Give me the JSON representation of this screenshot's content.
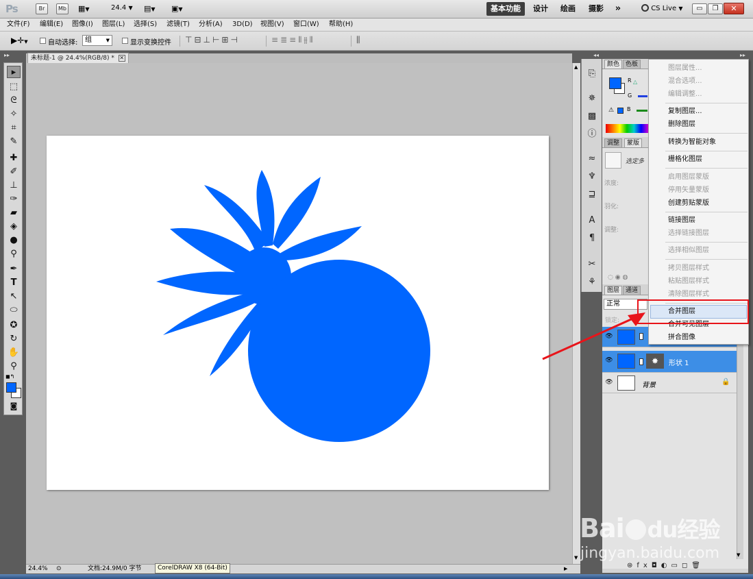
{
  "app": {
    "logo": "Ps",
    "bridge_btn": "Br",
    "minibridge_btn": "Mb",
    "zoom_value": "24.4",
    "workspaces": [
      "基本功能",
      "设计",
      "绘画",
      "摄影"
    ],
    "more": "»",
    "cs_live": "CS Live"
  },
  "menubar": {
    "items": [
      "文件(F)",
      "编辑(E)",
      "图像(I)",
      "图层(L)",
      "选择(S)",
      "滤镜(T)",
      "分析(A)",
      "3D(D)",
      "视图(V)",
      "窗口(W)",
      "帮助(H)"
    ]
  },
  "options": {
    "auto_select_label": "自动选择:",
    "auto_select_value": "组",
    "transform_label": "显示变换控件"
  },
  "document": {
    "tab_title": "未标题-1 @ 24.4%(RGB/8) *",
    "shape_color": "#0066ff",
    "canvas_color": "#ffffff"
  },
  "status": {
    "zoom": "24.4%",
    "doc_info": "文档:24.9M/0 字节",
    "taskbar_tooltip": "CorelDRAW X8 (64-Bit)"
  },
  "panels": {
    "color_tab": "颜色",
    "swatch_tab": "色板",
    "adjust_tab": "调整",
    "mask_tab": "蒙版",
    "mask_select": "选定多",
    "density_label": "浓度:",
    "feather_label": "羽化:",
    "refine_label": "调整:",
    "channels_r": "R",
    "channels_g": "G",
    "channels_b": "B",
    "layers_tab": "图层",
    "channels_tab": "通道",
    "blend_mode": "正常",
    "lock_label": "锁定:"
  },
  "layers": [
    {
      "name": "形状 1",
      "selected": true,
      "visible": true
    },
    {
      "name": "背景",
      "selected": false,
      "visible": true
    }
  ],
  "context_menu": {
    "groups": [
      [
        {
          "label": "图层属性...",
          "enabled": false
        },
        {
          "label": "混合选项...",
          "enabled": false
        },
        {
          "label": "编辑调整...",
          "enabled": false
        }
      ],
      [
        {
          "label": "复制图层...",
          "enabled": true
        },
        {
          "label": "删除图层",
          "enabled": true
        }
      ],
      [
        {
          "label": "转换为智能对象",
          "enabled": true
        }
      ],
      [
        {
          "label": "栅格化图层",
          "enabled": true
        }
      ],
      [
        {
          "label": "启用图层蒙版",
          "enabled": false
        },
        {
          "label": "停用矢量蒙版",
          "enabled": false
        },
        {
          "label": "创建剪贴蒙版",
          "enabled": true
        }
      ],
      [
        {
          "label": "链接图层",
          "enabled": true
        },
        {
          "label": "选择链接图层",
          "enabled": false
        }
      ],
      [
        {
          "label": "选择相似图层",
          "enabled": false
        }
      ],
      [
        {
          "label": "拷贝图层样式",
          "enabled": false
        },
        {
          "label": "粘贴图层样式",
          "enabled": false
        },
        {
          "label": "清除图层样式",
          "enabled": false
        }
      ],
      [
        {
          "label": "合并图层",
          "enabled": true,
          "highlighted": true
        },
        {
          "label": "合并可见图层",
          "enabled": true
        },
        {
          "label": "拼合图像",
          "enabled": true
        }
      ]
    ]
  },
  "annotation": {
    "arrow_color": "#e8141a"
  },
  "watermark": {
    "brand": "Bai",
    "brand_suffix": "经验",
    "url": "jingyan.baidu.com"
  }
}
